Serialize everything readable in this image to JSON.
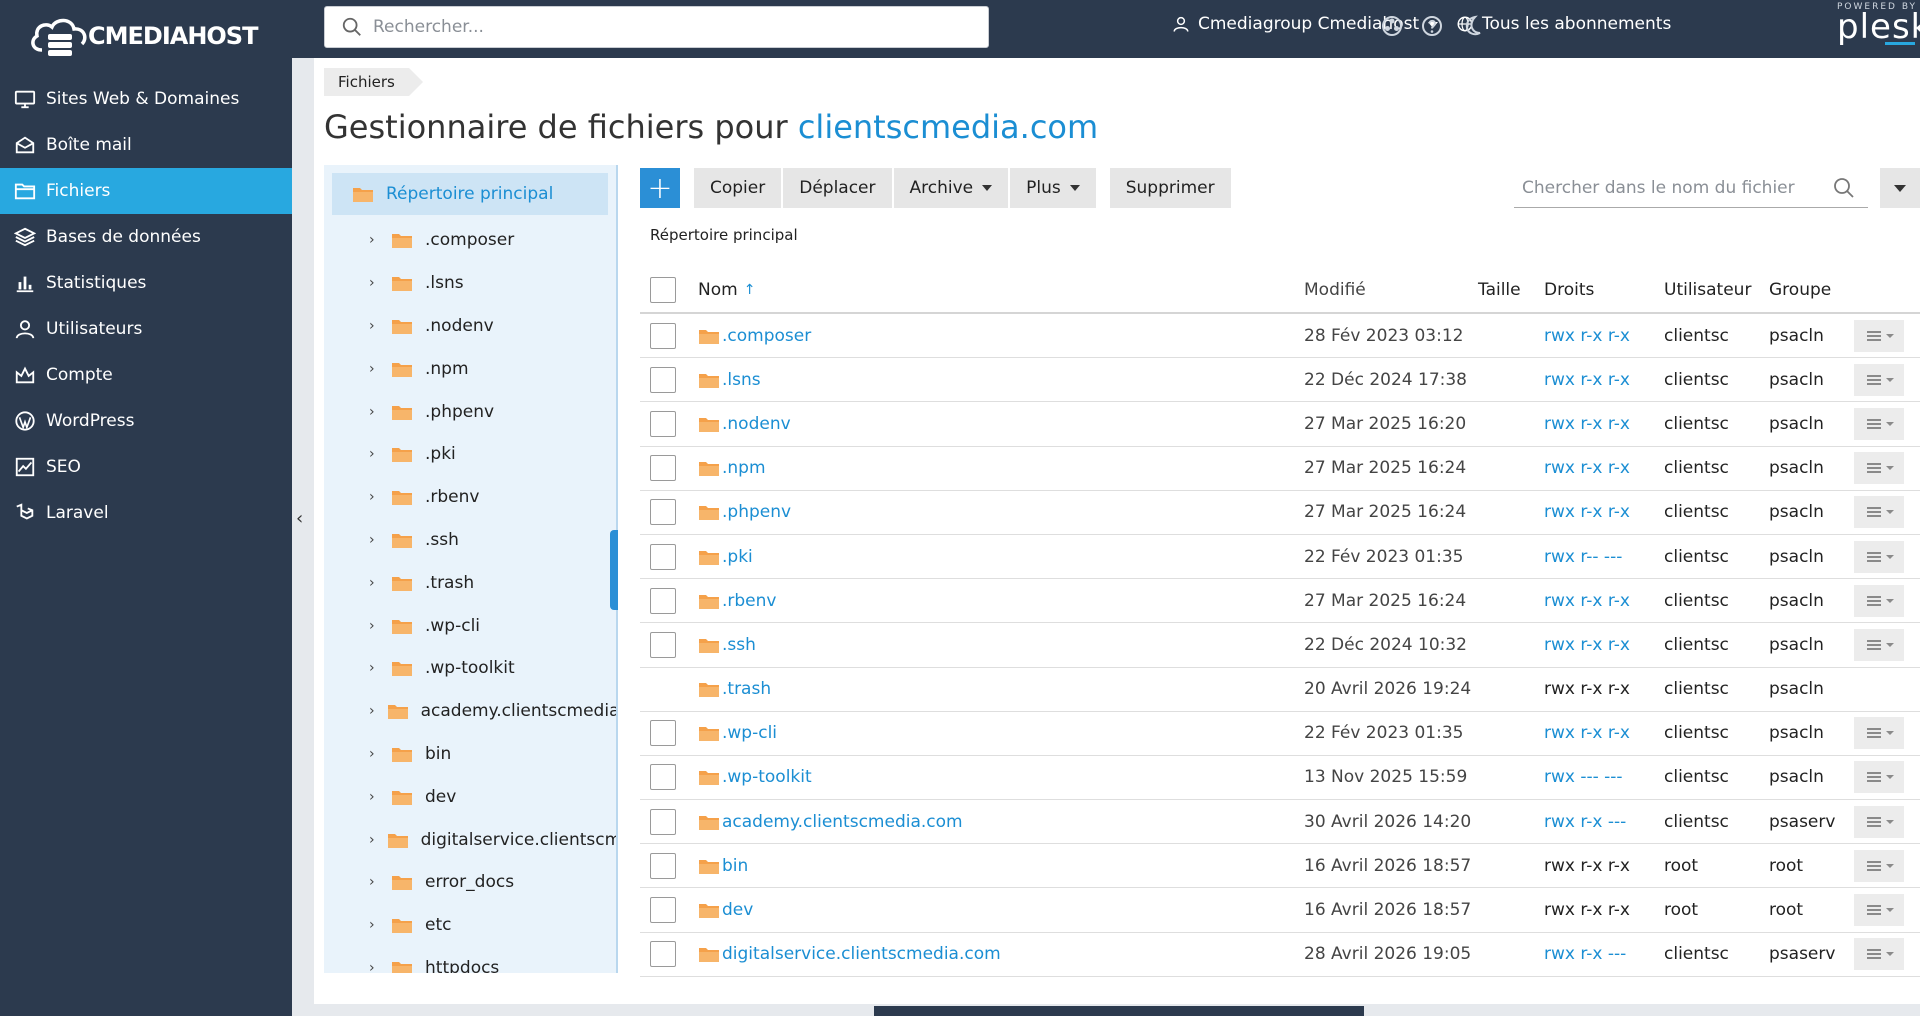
{
  "brand": {
    "logo_text": "CMEDIAHOST"
  },
  "sidebar": {
    "items": [
      {
        "label": "Sites Web & Domaines",
        "icon": "monitor-icon"
      },
      {
        "label": "Boîte mail",
        "icon": "mail-icon"
      },
      {
        "label": "Fichiers",
        "icon": "folder-icon",
        "active": true
      },
      {
        "label": "Bases de données",
        "icon": "database-icon"
      },
      {
        "label": "Statistiques",
        "icon": "bar-chart-icon"
      },
      {
        "label": "Utilisateurs",
        "icon": "user-icon"
      },
      {
        "label": "Compte",
        "icon": "account-icon"
      },
      {
        "label": "WordPress",
        "icon": "wordpress-icon"
      },
      {
        "label": "SEO",
        "icon": "seo-icon"
      },
      {
        "label": "Laravel",
        "icon": "laravel-icon"
      }
    ]
  },
  "topbar": {
    "search_placeholder": "Rechercher...",
    "user_label": "Cmediagroup Cmediahost",
    "subscriptions_label": "Tous les abonnements",
    "powered_by": "POWERED BY",
    "plesk_label": "plesk"
  },
  "breadcrumb": {
    "label": "Fichiers"
  },
  "page": {
    "title_prefix": "Gestionnaire de fichiers pour ",
    "title_domain": "clientscmedia.com"
  },
  "tree": {
    "root_label": "Répertoire principal",
    "items": [
      ".composer",
      ".lsns",
      ".nodenv",
      ".npm",
      ".phpenv",
      ".pki",
      ".rbenv",
      ".ssh",
      ".trash",
      ".wp-cli",
      ".wp-toolkit",
      "academy.clientscmedia.com",
      "bin",
      "dev",
      "digitalservice.clientscmedia.com",
      "error_docs",
      "etc",
      "httpdocs"
    ]
  },
  "toolbar": {
    "add_label": "+",
    "copy_label": "Copier",
    "move_label": "Déplacer",
    "archive_label": "Archive",
    "more_label": "Plus",
    "delete_label": "Supprimer",
    "file_search_placeholder": "Chercher dans le nom du fichier"
  },
  "current_dir_label": "Répertoire principal",
  "table": {
    "headers": {
      "name": "Nom",
      "sort_indicator": "↑",
      "modified": "Modifié",
      "size": "Taille",
      "perms": "Droits",
      "user": "Utilisateur",
      "group": "Groupe"
    },
    "rows": [
      {
        "name": ".composer",
        "modified": "28 Fév 2023 03:12",
        "perms": "rwx r-x r-x",
        "perm_link": true,
        "user": "clientsc",
        "group": "psacln",
        "has_checkbox": true,
        "has_actions": true
      },
      {
        "name": ".lsns",
        "modified": "22 Déc 2024 17:38",
        "perms": "rwx r-x r-x",
        "perm_link": true,
        "user": "clientsc",
        "group": "psacln",
        "has_checkbox": true,
        "has_actions": true
      },
      {
        "name": ".nodenv",
        "modified": "27 Mar 2025 16:20",
        "perms": "rwx r-x r-x",
        "perm_link": true,
        "user": "clientsc",
        "group": "psacln",
        "has_checkbox": true,
        "has_actions": true
      },
      {
        "name": ".npm",
        "modified": "27 Mar 2025 16:24",
        "perms": "rwx r-x r-x",
        "perm_link": true,
        "user": "clientsc",
        "group": "psacln",
        "has_checkbox": true,
        "has_actions": true
      },
      {
        "name": ".phpenv",
        "modified": "27 Mar 2025 16:24",
        "perms": "rwx r-x r-x",
        "perm_link": true,
        "user": "clientsc",
        "group": "psacln",
        "has_checkbox": true,
        "has_actions": true
      },
      {
        "name": ".pki",
        "modified": "22 Fév 2023 01:35",
        "perms": "rwx r-- ---",
        "perm_link": true,
        "user": "clientsc",
        "group": "psacln",
        "has_checkbox": true,
        "has_actions": true
      },
      {
        "name": ".rbenv",
        "modified": "27 Mar 2025 16:24",
        "perms": "rwx r-x r-x",
        "perm_link": true,
        "user": "clientsc",
        "group": "psacln",
        "has_checkbox": true,
        "has_actions": true
      },
      {
        "name": ".ssh",
        "modified": "22 Déc 2024 10:32",
        "perms": "rwx r-x r-x",
        "perm_link": true,
        "user": "clientsc",
        "group": "psacln",
        "has_checkbox": true,
        "has_actions": true
      },
      {
        "name": ".trash",
        "modified": "20 Avril 2026 19:24",
        "perms": "rwx r-x r-x",
        "perm_link": false,
        "user": "clientsc",
        "group": "psacln",
        "has_checkbox": false,
        "has_actions": false
      },
      {
        "name": ".wp-cli",
        "modified": "22 Fév 2023 01:35",
        "perms": "rwx r-x r-x",
        "perm_link": true,
        "user": "clientsc",
        "group": "psacln",
        "has_checkbox": true,
        "has_actions": true
      },
      {
        "name": ".wp-toolkit",
        "modified": "13 Nov 2025 15:59",
        "perms": "rwx --- ---",
        "perm_link": true,
        "user": "clientsc",
        "group": "psacln",
        "has_checkbox": true,
        "has_actions": true
      },
      {
        "name": "academy.clientscmedia.com",
        "modified": "30 Avril 2026 14:20",
        "perms": "rwx r-x ---",
        "perm_link": true,
        "user": "clientsc",
        "group": "psaserv",
        "has_checkbox": true,
        "has_actions": true
      },
      {
        "name": "bin",
        "modified": "16 Avril 2026 18:57",
        "perms": "rwx r-x r-x",
        "perm_link": false,
        "user": "root",
        "group": "root",
        "has_checkbox": true,
        "has_actions": true
      },
      {
        "name": "dev",
        "modified": "16 Avril 2026 18:57",
        "perms": "rwx r-x r-x",
        "perm_link": false,
        "user": "root",
        "group": "root",
        "has_checkbox": true,
        "has_actions": true
      },
      {
        "name": "digitalservice.clientscmedia.com",
        "modified": "28 Avril 2026 19:05",
        "perms": "rwx r-x ---",
        "perm_link": true,
        "user": "clientsc",
        "group": "psaserv",
        "has_checkbox": true,
        "has_actions": true
      }
    ]
  },
  "colors": {
    "sidebar_bg": "#2c3a4e",
    "accent": "#28a8e0",
    "link": "#1b8ed3",
    "folder": "#f5a14a"
  }
}
